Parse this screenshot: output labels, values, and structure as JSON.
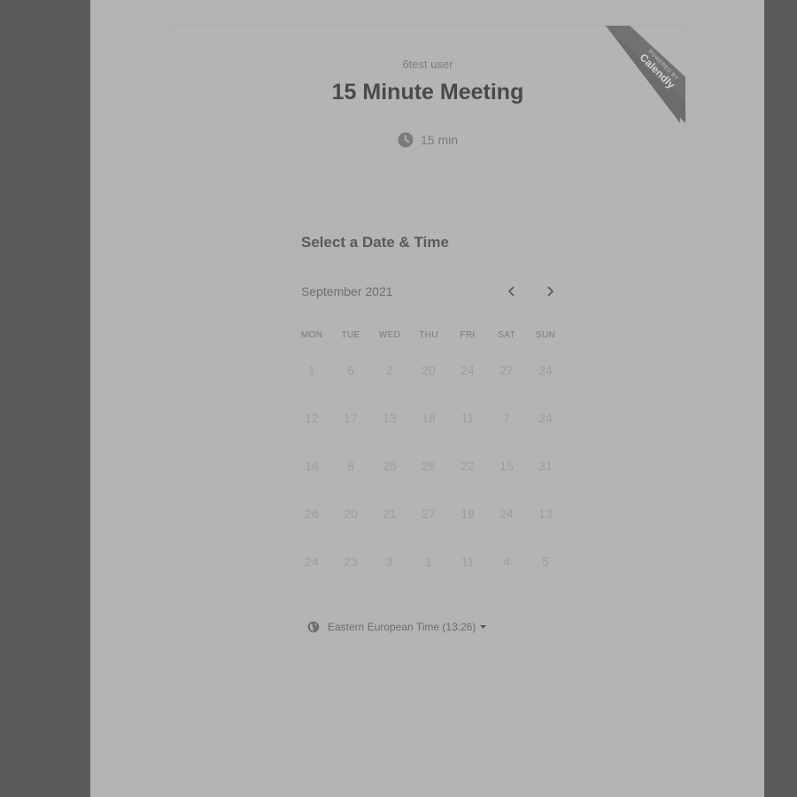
{
  "event": {
    "organizer": "6test user",
    "title": "15 Minute Meeting",
    "duration": "15 min"
  },
  "badge": {
    "small_text": "POWERED BY",
    "brand": "Calendly"
  },
  "scheduler": {
    "heading": "Select a Date & Time",
    "month_label": "September 2021",
    "weekdays": [
      "MON",
      "TUE",
      "WED",
      "THU",
      "FRI",
      "SAT",
      "SUN"
    ],
    "days": [
      [
        "1",
        "6",
        "2",
        "20",
        "24",
        "27",
        "24"
      ],
      [
        "12",
        "17",
        "13",
        "18",
        "11",
        "7",
        "24"
      ],
      [
        "16",
        "8",
        "25",
        "26",
        "22",
        "15",
        "31"
      ],
      [
        "26",
        "20",
        "21",
        "27",
        "19",
        "24",
        "13"
      ],
      [
        "24",
        "23",
        "3",
        "1",
        "11",
        "4",
        "5"
      ]
    ],
    "timezone": "Eastern European Time (13:26)"
  },
  "icons": {
    "clock": "clock-icon",
    "globe": "globe-icon",
    "prev": "chevron-left-icon",
    "next": "chevron-right-icon",
    "caret": "caret-down-icon"
  }
}
